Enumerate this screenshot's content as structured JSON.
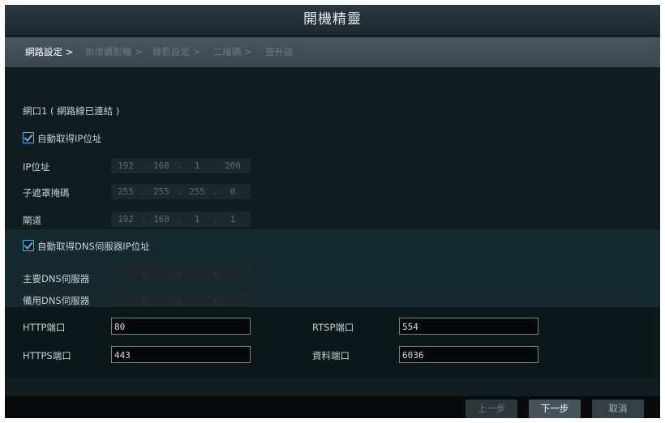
{
  "window": {
    "title": "開機精靈"
  },
  "steps": [
    {
      "label": "網路設定 >"
    },
    {
      "label": "新增攝影機 >"
    },
    {
      "label": "錄影設定 >"
    },
    {
      "label": "二維碼 >"
    },
    {
      "label": "晉升級"
    }
  ],
  "network": {
    "section_label": "網口1 ( 網路線已連結 )",
    "auto_ip_label": "自動取得IP位址",
    "auto_ip_checked": true,
    "ip_label": "IP位址",
    "ip": [
      "192",
      "168",
      "1",
      "200"
    ],
    "subnet_label": "子遮罩掩碼",
    "subnet": [
      "255",
      "255",
      "255",
      "0"
    ],
    "gateway_label": "閘道",
    "gateway": [
      "192",
      "168",
      "1",
      "1"
    ],
    "auto_dns_label": "自動取得DNS伺服器IP位址",
    "auto_dns_checked": true,
    "primary_dns_label": "主要DNS伺服器",
    "secondary_dns_label": "備用DNS伺服器"
  },
  "ports": {
    "http_label": "HTTP端口",
    "http_value": "80",
    "https_label": "HTTPS端口",
    "https_value": "443",
    "rtsp_label": "RTSP端口",
    "rtsp_value": "554",
    "data_label": "資料端口",
    "data_value": "6036"
  },
  "buttons": {
    "prev": "上一步",
    "next": "下一步",
    "cancel": "取消"
  }
}
